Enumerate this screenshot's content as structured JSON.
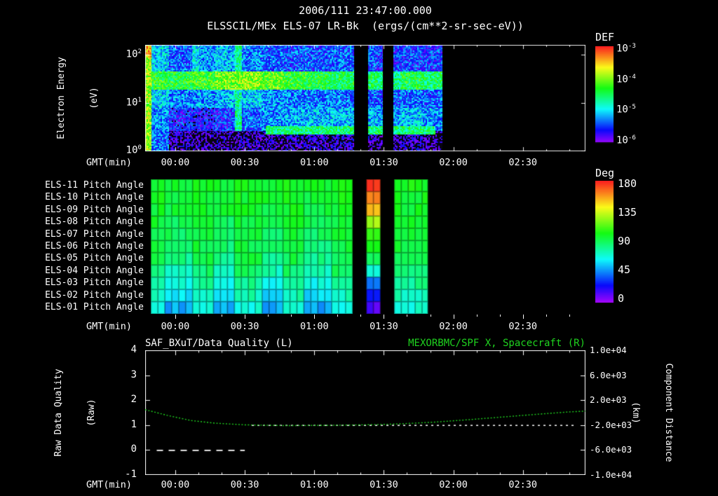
{
  "header": {
    "timestamp": "2006/111 23:47:00.000",
    "title": "ELSSCIL/MEx ELS-07 LR-Bk  (ergs/(cm**2-sr-sec-eV))"
  },
  "gmt_label": "GMT(min)",
  "x_ticks": [
    {
      "label": "00:00",
      "min": 13
    },
    {
      "label": "00:30",
      "min": 43
    },
    {
      "label": "01:00",
      "min": 73
    },
    {
      "label": "01:30",
      "min": 103
    },
    {
      "label": "02:00",
      "min": 133
    },
    {
      "label": "02:30",
      "min": 163
    }
  ],
  "spectrogram": {
    "ylabel1": "Electron Energy",
    "ylabel2": "(eV)",
    "ytick_exponents": [
      2,
      1,
      0
    ],
    "colorbar": {
      "title": "DEF",
      "tick_exponents": [
        -3,
        -4,
        -5,
        -6
      ]
    }
  },
  "pitch": {
    "row_labels": [
      "ELS-11 Pitch Angle",
      "ELS-10 Pitch Angle",
      "ELS-09 Pitch Angle",
      "ELS-08 Pitch Angle",
      "ELS-07 Pitch Angle",
      "ELS-06 Pitch Angle",
      "ELS-05 Pitch Angle",
      "ELS-04 Pitch Angle",
      "ELS-03 Pitch Angle",
      "ELS-02 Pitch Angle",
      "ELS-01 Pitch Angle"
    ],
    "colorbar": {
      "title": "Deg",
      "ticks": [
        180,
        135,
        90,
        45,
        0
      ]
    }
  },
  "bottom": {
    "title_left": "SAF_BXuT/Data Quality (L)",
    "title_right": "MEXORBMC/SPF X, Spacecraft (R)",
    "ylabel_left1": "Raw Data Quality",
    "ylabel_left2": "(Raw)",
    "ylabel_right1": "Component Distance",
    "ylabel_right2": "(km)",
    "left_ticks": [
      "4",
      "3",
      "2",
      "1",
      "0",
      "-1"
    ],
    "right_ticks": [
      "1.0e+04",
      "6.0e+03",
      "2.0e+03",
      "-2.0e+03",
      "-6.0e+03",
      "-1.0e+04"
    ]
  },
  "colors": {
    "text": "#ffffff",
    "background": "#000000",
    "accent_green": "#1fd41f"
  },
  "chart_data": [
    {
      "type": "heatmap",
      "name": "electron_energy_spectrogram",
      "title": "ELSSCIL/MEx ELS-07 LR-Bk",
      "units": "ergs/(cm**2-sr-sec-eV)",
      "xlabel": "GMT(min)",
      "ylabel": "Electron Energy (eV)",
      "x_start": "2006/111 23:47",
      "x_total_min": 190,
      "x_tick_labels": [
        "00:00",
        "00:30",
        "01:00",
        "01:30",
        "02:00",
        "02:30"
      ],
      "x_tick_min": [
        13,
        43,
        73,
        103,
        133,
        163
      ],
      "yscale": "log",
      "energy_row_bounds_log10": [
        2.2,
        1.66,
        1.28,
        0.9,
        0.42,
        0
      ],
      "energy_rows_eV": [
        100,
        30,
        10,
        3,
        1
      ],
      "time_bin_min": 10,
      "values_log10_def": [
        [
          -5.0,
          -5.35,
          -5.2,
          -5.1,
          -5.25,
          -5.35,
          -5.4,
          -5.4,
          -5.35,
          -5.4,
          -5.5,
          -5.45,
          -5.5
        ],
        [
          -4.3,
          -4.35,
          -4.25,
          -4.05,
          -4.0,
          -4.15,
          -4.3,
          -4.4,
          -4.45,
          -4.5,
          -4.6,
          -4.4,
          -4.5
        ],
        [
          -5.0,
          -5.25,
          -5.2,
          -5.1,
          -5.05,
          -5.2,
          -5.25,
          -5.3,
          -5.3,
          -5.35,
          -5.4,
          -5.3,
          -5.35
        ],
        [
          -5.2,
          -5.55,
          -5.6,
          -5.5,
          -5.35,
          -5.25,
          -5.15,
          -5.1,
          -5.1,
          -5.15,
          -5.2,
          -5.1,
          -5.2
        ],
        [
          -5.3,
          -5.9,
          -6.0,
          -6.0,
          -5.9,
          -5.95,
          -5.9,
          -5.9,
          -5.85,
          -5.95,
          -6.0,
          -5.9,
          -6.0
        ]
      ],
      "data_gaps_min": [
        [
          90,
          96
        ],
        [
          102.5,
          107
        ]
      ],
      "data_end_min": 128,
      "features": [
        {
          "name": "bright-edge",
          "t": [
            0,
            2.5
          ],
          "e": [
            0,
            2.2
          ],
          "log10_def": -3.9
        },
        {
          "name": "bright-edge-top-red",
          "t": [
            0,
            2.5
          ],
          "e": [
            1.95,
            2.2
          ],
          "log10_def": -3.4
        },
        {
          "name": "cyan-streak",
          "t": [
            38.5,
            41.5
          ],
          "e": [
            0.42,
            2.2
          ],
          "log10_def": -4.7
        },
        {
          "name": "top-green-patch",
          "t": [
            20,
            23
          ],
          "e": [
            1.66,
            2.2
          ],
          "log10_def": -4.9
        },
        {
          "name": "low-energy-band",
          "t": [
            52,
            125
          ],
          "e": [
            0.34,
            0.52
          ],
          "log10_def": -4.55
        }
      ],
      "colorbar": {
        "title": "DEF",
        "scale": "log10",
        "ticks": [
          -3,
          -4,
          -5,
          -6
        ],
        "range": [
          -6,
          -3
        ]
      }
    },
    {
      "type": "heatmap",
      "name": "pitch_angle_panel",
      "rows": [
        "ELS-11",
        "ELS-10",
        "ELS-09",
        "ELS-08",
        "ELS-07",
        "ELS-06",
        "ELS-05",
        "ELS-04",
        "ELS-03",
        "ELS-02",
        "ELS-01"
      ],
      "units": "Deg",
      "time_bin_min": 10,
      "cell_min": 3,
      "data_start_min": 2.5,
      "data_end_min": 122,
      "data_gaps_min": [
        [
          90,
          96
        ],
        [
          102.5,
          107
        ]
      ],
      "special_column": {
        "t": [
          96,
          102.5
        ],
        "values_deg": [
          176,
          166,
          148,
          128,
          110,
          100,
          90,
          68,
          42,
          26,
          12
        ]
      },
      "values_deg": [
        [
          102,
          99,
          102,
          99,
          102,
          99,
          102,
          99,
          102,
          176,
          102,
          102,
          102
        ],
        [
          100,
          97,
          100,
          97,
          100,
          97,
          100,
          97,
          100,
          166,
          100,
          100,
          100
        ],
        [
          99,
          95,
          99,
          95,
          99,
          95,
          99,
          95,
          99,
          148,
          99,
          99,
          99
        ],
        [
          97,
          91,
          97,
          91,
          97,
          91,
          97,
          91,
          97,
          128,
          97,
          97,
          97
        ],
        [
          96,
          89,
          96,
          89,
          96,
          89,
          96,
          89,
          96,
          110,
          96,
          96,
          96
        ],
        [
          95,
          87,
          95,
          87,
          95,
          87,
          95,
          87,
          95,
          100,
          95,
          95,
          95
        ],
        [
          93,
          83,
          93,
          83,
          93,
          83,
          93,
          83,
          93,
          90,
          93,
          93,
          93
        ],
        [
          88,
          75,
          88,
          75,
          88,
          75,
          88,
          75,
          88,
          68,
          88,
          88,
          88
        ],
        [
          82,
          67,
          82,
          67,
          82,
          67,
          82,
          67,
          82,
          42,
          82,
          82,
          82
        ],
        [
          76,
          59,
          76,
          59,
          76,
          59,
          76,
          59,
          76,
          26,
          76,
          76,
          76
        ],
        [
          70,
          51,
          70,
          51,
          70,
          51,
          70,
          51,
          70,
          12,
          70,
          70,
          70
        ]
      ],
      "colorbar": {
        "title": "Deg",
        "ticks": [
          180,
          135,
          90,
          45,
          0
        ],
        "range": [
          0,
          180
        ]
      }
    },
    {
      "type": "line",
      "name": "quality_and_spacecraft_distance",
      "xlabel": "GMT(min)",
      "x_tick_labels": [
        "00:00",
        "00:30",
        "01:00",
        "01:30",
        "02:00",
        "02:30"
      ],
      "x_tick_min": [
        13,
        43,
        73,
        103,
        133,
        163
      ],
      "left_axis": {
        "label": "Raw Data Quality (Raw)",
        "range": [
          -1,
          4
        ],
        "ticks": [
          4,
          3,
          2,
          1,
          0,
          -1
        ]
      },
      "right_axis": {
        "label": "Component Distance (km)",
        "range": [
          -10000,
          10000
        ],
        "ticks": [
          10000,
          6000,
          2000,
          -2000,
          -6000,
          -10000
        ]
      },
      "series": [
        {
          "name": "SAF_BXuT/Data Quality (L)",
          "axis": "left",
          "style": "white-dashed",
          "color": "#ffffff",
          "segments": [
            {
              "value": 0,
              "t": [
                5,
                43
              ]
            },
            {
              "value": 1,
              "t": [
                46,
                186
              ]
            }
          ]
        },
        {
          "name": "MEXORBMC/SPF X, Spacecraft (R)",
          "axis": "right",
          "style": "green-dotted",
          "color": "#1fd41f",
          "points_min": [
            0,
            10,
            20,
            30,
            43,
            60,
            80,
            100,
            110,
            125,
            140,
            155,
            170,
            183,
            190
          ],
          "values_km": [
            480,
            -480,
            -1280,
            -1680,
            -1960,
            -2080,
            -2040,
            -1920,
            -1800,
            -1520,
            -1120,
            -680,
            -240,
            120,
            240
          ]
        }
      ]
    }
  ]
}
